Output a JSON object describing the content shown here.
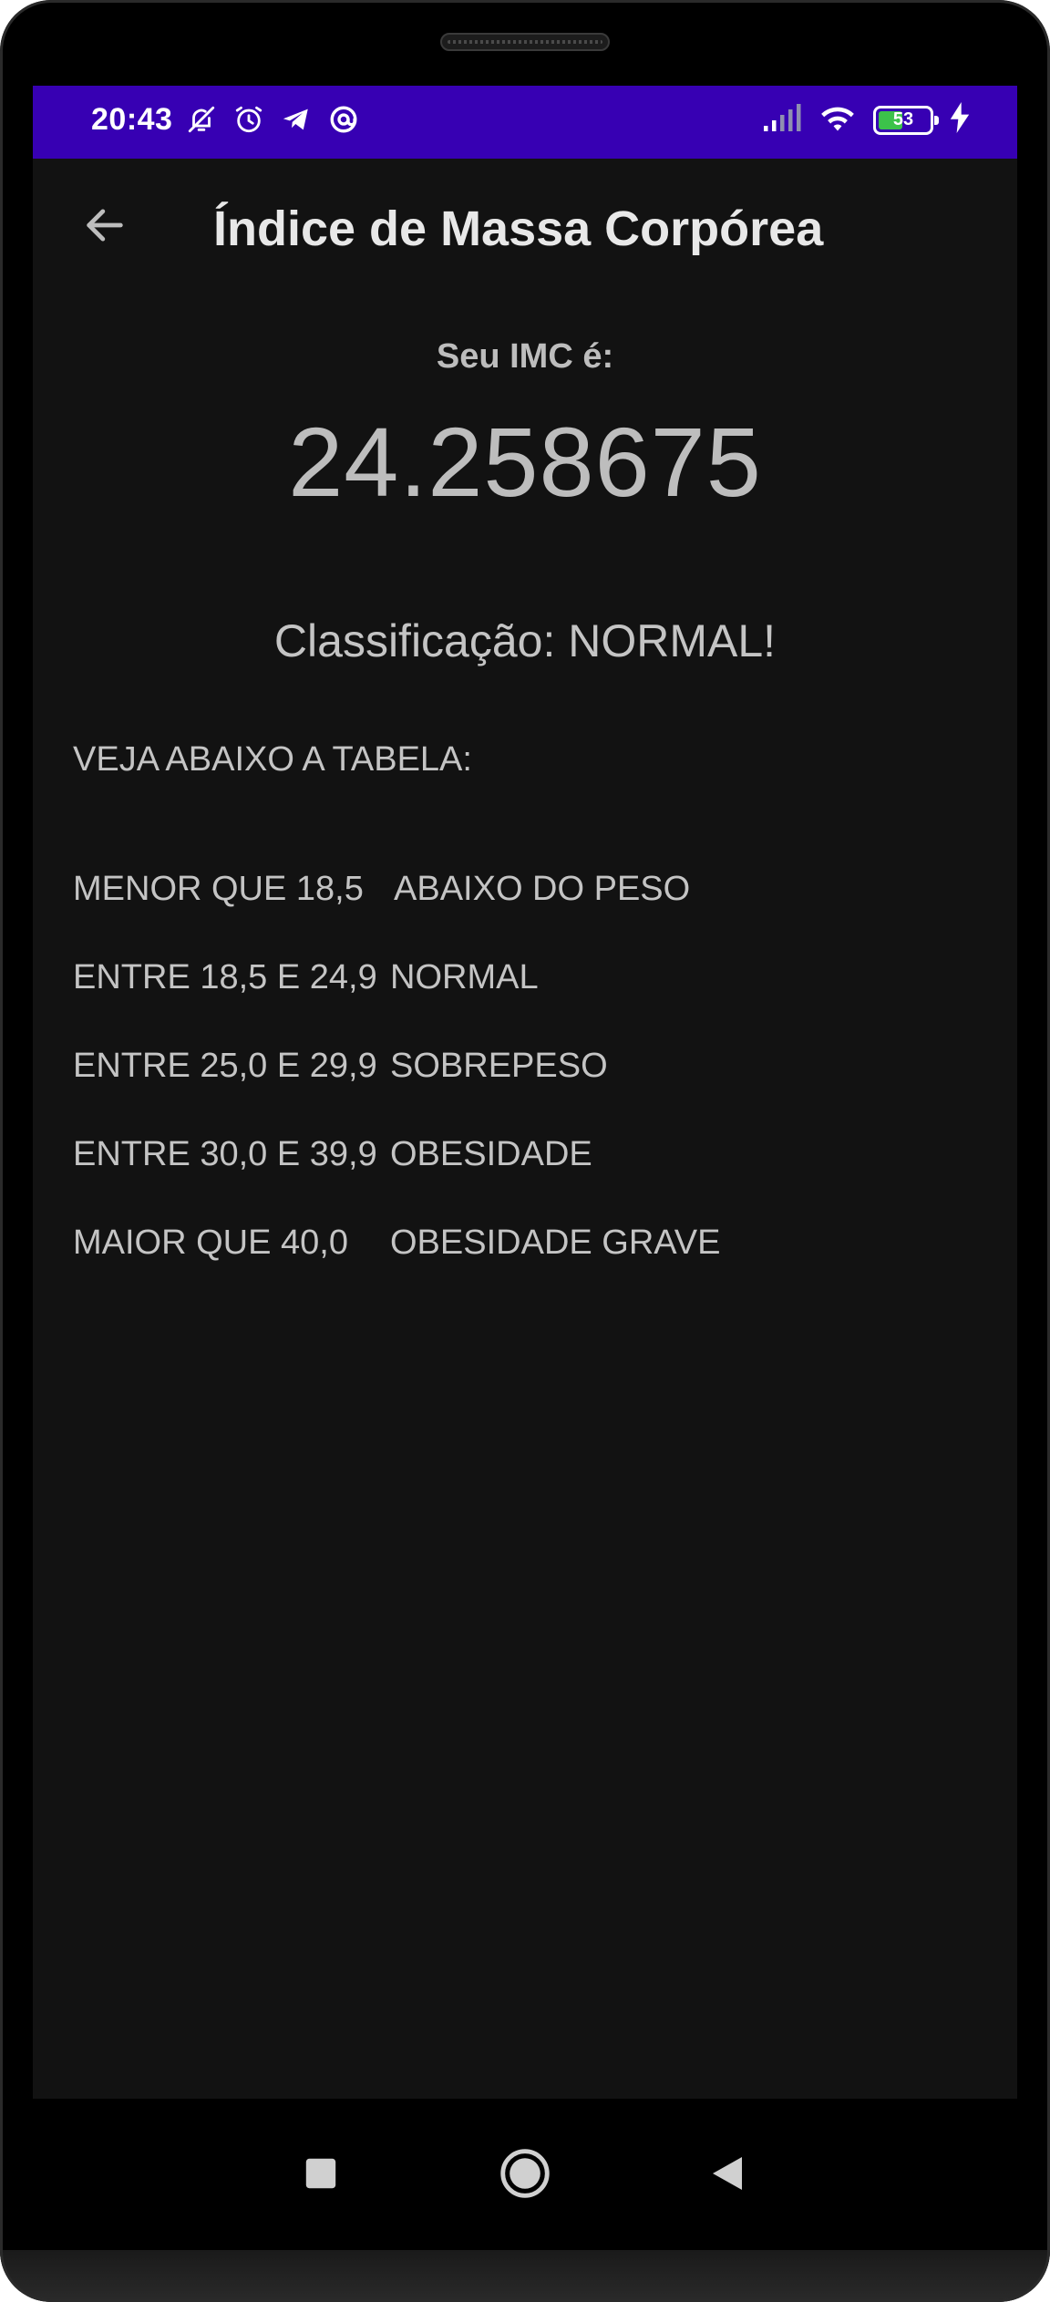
{
  "status_bar": {
    "time": "20:43",
    "battery_level": 53,
    "battery_text": "53",
    "left_icons": [
      "mute-notifications-icon",
      "alarm-icon",
      "telegram-icon",
      "at-sign-icon"
    ],
    "right_icons": [
      "signal-icon",
      "wifi-icon",
      "battery-icon",
      "charging-icon"
    ],
    "color": "#3700b3"
  },
  "app_bar": {
    "title": "Índice de Massa Corpórea",
    "back_icon": "arrow-back-icon"
  },
  "result": {
    "label": "Seu IMC é:",
    "value": "24.258675",
    "classification": "Classificação: NORMAL!"
  },
  "table": {
    "heading": "VEJA ABAIXO A TABELA:",
    "rows": [
      {
        "range": "MENOR QUE 18,5",
        "class": "ABAIXO DO PESO"
      },
      {
        "range": "ENTRE 18,5 E 24,9",
        "class": "NORMAL"
      },
      {
        "range": "ENTRE 25,0 E 29,9",
        "class": "SOBREPESO"
      },
      {
        "range": "ENTRE 30,0 E 39,9",
        "class": "OBESIDADE"
      },
      {
        "range": "MAIOR QUE 40,0",
        "class": "OBESIDADE GRAVE"
      }
    ]
  },
  "nav_bar": {
    "buttons": [
      "recents-square-icon",
      "home-circle-icon",
      "back-triangle-icon"
    ]
  },
  "colors": {
    "background": "#121212",
    "text": "#c4c4c4",
    "title": "#e8e8e8",
    "accent": "#3700b3"
  }
}
